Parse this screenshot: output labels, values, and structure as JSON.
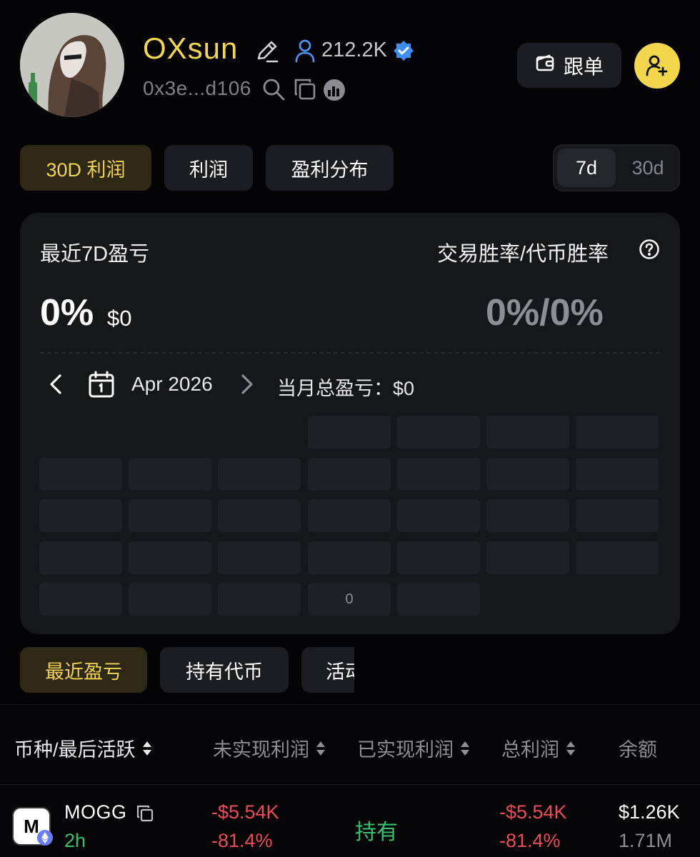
{
  "profile": {
    "name": "OXsun",
    "followers": "212.2K",
    "address": "0x3e...d106"
  },
  "actions": {
    "follow_trade_label": "跟单"
  },
  "tabs": [
    {
      "label": "30D 利润",
      "active": true
    },
    {
      "label": "利润",
      "active": false
    },
    {
      "label": "盈利分布",
      "active": false
    }
  ],
  "period": {
    "options": [
      "7d",
      "30d"
    ],
    "selected": "7d"
  },
  "summary": {
    "pnl_label": "最近7D盈亏",
    "pnl_percent": "0%",
    "pnl_usd": "$0",
    "winrate_label": "交易胜率/代币胜率",
    "winrate_value": "0%/0%"
  },
  "calendar": {
    "month": "Apr 2026",
    "month_total": "当月总盈亏：$0",
    "marked_cell_value": "0"
  },
  "tabs2": [
    {
      "label": "最近盈亏",
      "active": true
    },
    {
      "label": "持有代币",
      "active": false
    },
    {
      "label": "活动",
      "active": false
    }
  ],
  "table": {
    "headers": [
      "币种/最后活跃",
      "未实现利润",
      "已实现利润",
      "总利润",
      "余额"
    ],
    "rows": [
      {
        "logo_letter": "M",
        "token": "MOGG",
        "last_active": "2h",
        "unrealized_usd": "-$5.54K",
        "unrealized_pct": "-81.4%",
        "realized": "持有",
        "total_usd": "-$5.54K",
        "total_pct": "-81.4%",
        "balance_usd": "$1.26K",
        "balance_amount": "1.71M"
      }
    ]
  },
  "colors": {
    "accent_yellow": "#f2d64c",
    "loss_red": "#ec4b57",
    "gain_green": "#35c26f",
    "verified_blue": "#3d8ef0"
  }
}
